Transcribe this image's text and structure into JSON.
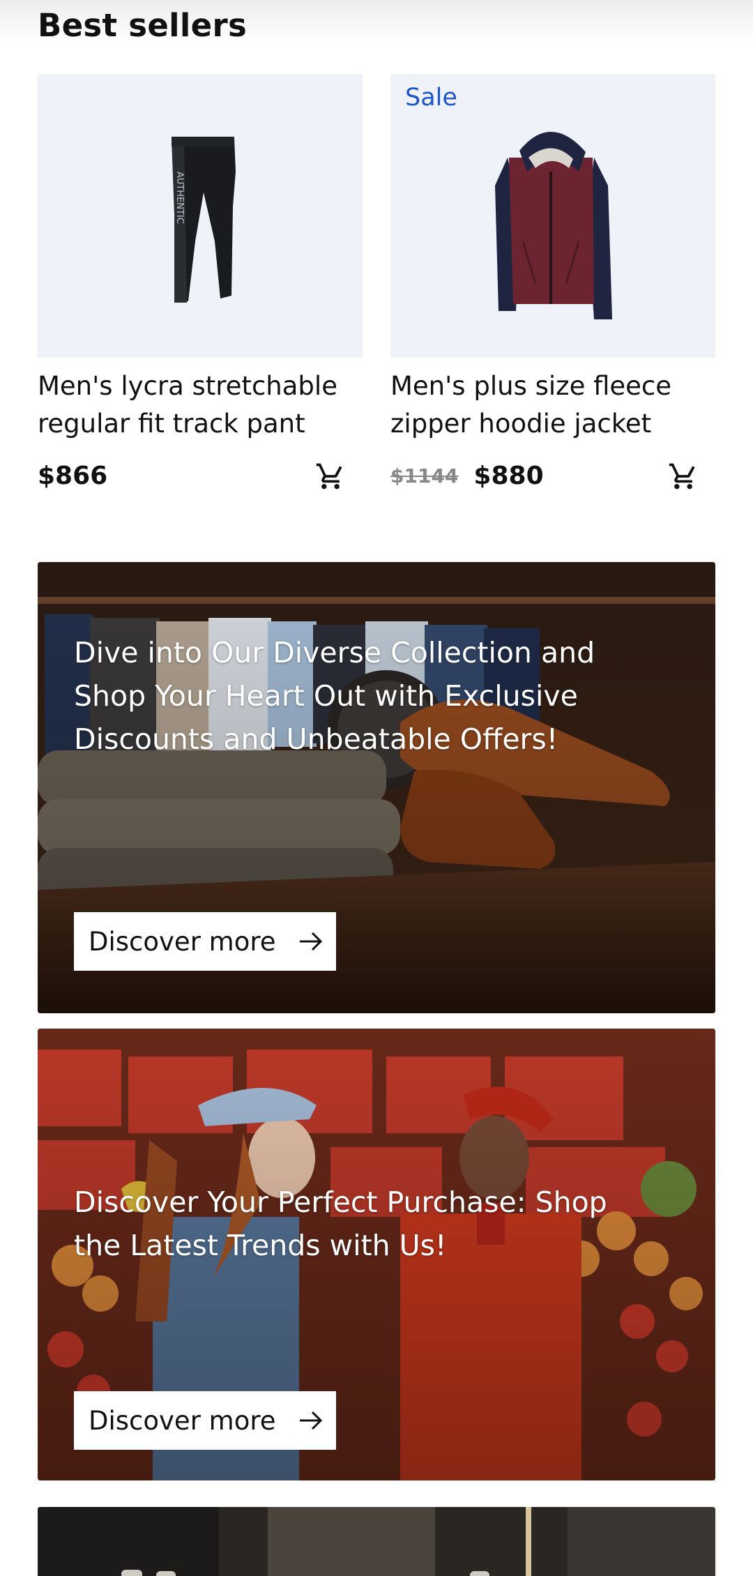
{
  "section": {
    "title": "Best sellers"
  },
  "products": [
    {
      "name": "Men's lycra stretchable regular fit track pant",
      "price": "$866",
      "image_icon": "track-pant-image",
      "cart_icon": "cart-icon"
    },
    {
      "badge": "Sale",
      "name": "Men's plus size fleece zipper hoodie jacket",
      "old_price": "$1144",
      "price": "$880",
      "image_icon": "hoodie-jacket-image",
      "cart_icon": "cart-icon"
    }
  ],
  "banners": [
    {
      "headline": "Dive into Our Diverse Collection and Shop Your Heart Out with Exclusive Discounts and Unbeatable Offers!",
      "button_label": "Discover more",
      "image": "shoes-and-clothing-rack-photo"
    },
    {
      "headline": "Discover Your Perfect Purchase: Shop the Latest Trends with Us!",
      "button_label": "Discover more",
      "image": "two-women-in-market-photo"
    },
    {
      "image": "store-interior-photo"
    }
  ],
  "colors": {
    "sale_badge": "#1f56c7",
    "card_background": "#eff2f8",
    "old_price": "#888888"
  }
}
